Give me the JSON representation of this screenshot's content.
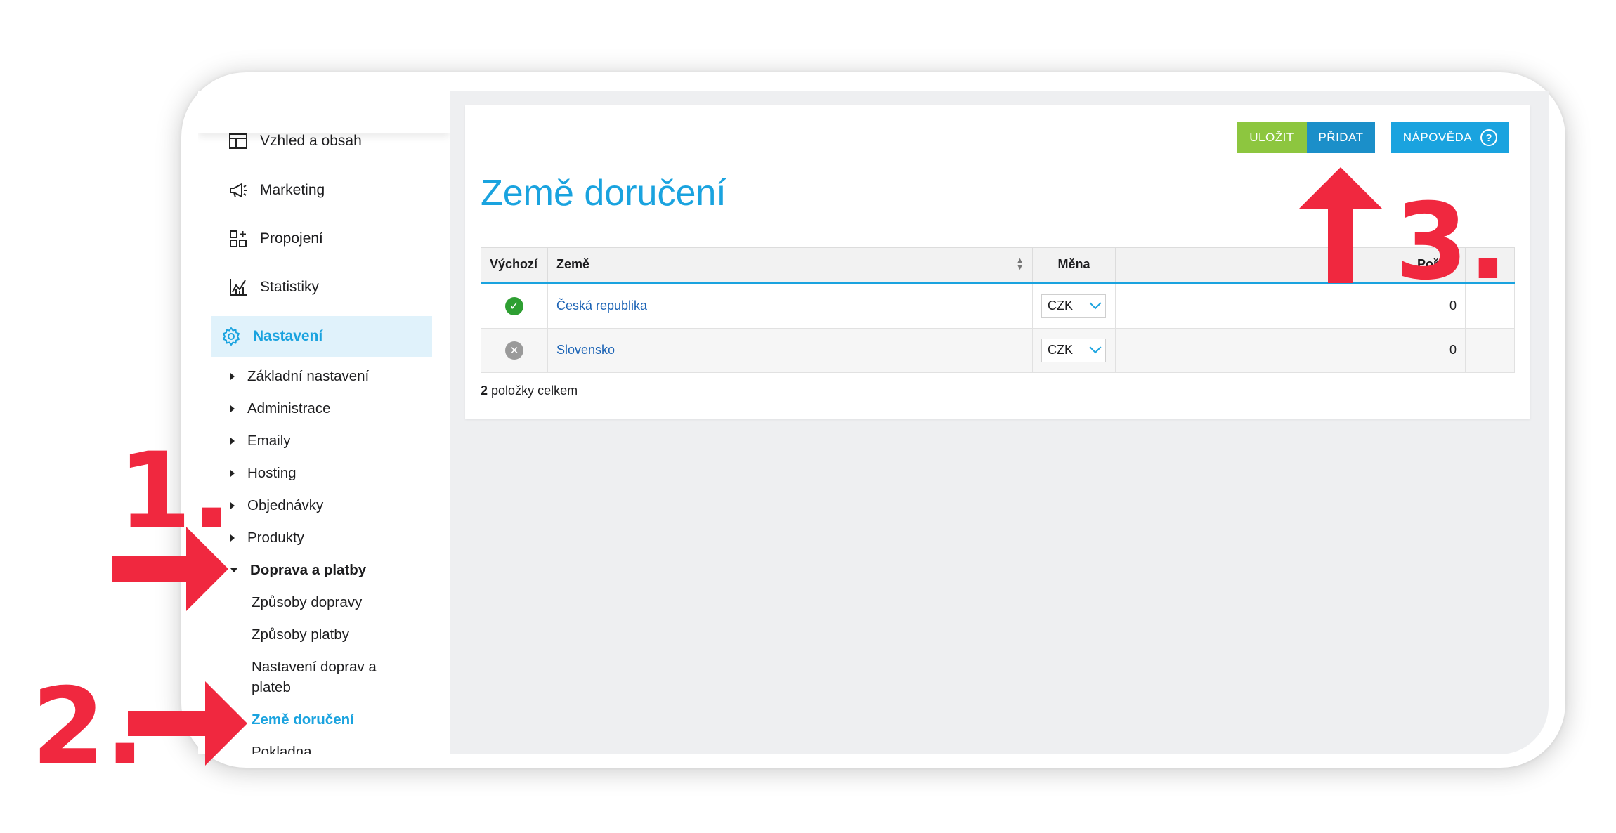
{
  "sidebar": {
    "items": [
      {
        "label": "Vzhled a obsah",
        "icon": "layout-icon"
      },
      {
        "label": "Marketing",
        "icon": "megaphone-icon"
      },
      {
        "label": "Propojení",
        "icon": "apps-plus-icon"
      },
      {
        "label": "Statistiky",
        "icon": "chart-icon"
      },
      {
        "label": "Nastavení",
        "icon": "gear-icon",
        "active": true
      }
    ],
    "settings_children": [
      "Základní nastavení",
      "Administrace",
      "Emaily",
      "Hosting",
      "Objednávky",
      "Produkty",
      "Doprava a platby"
    ],
    "shipping_children": [
      "Způsoby dopravy",
      "Způsoby platby",
      "Nastavení doprav a plateb",
      "Země doručení",
      "Pokladna"
    ]
  },
  "toolbar": {
    "save_label": "ULOŽIT",
    "add_label": "PŘIDAT",
    "help_label": "NÁPOVĚDA",
    "help_symbol": "?"
  },
  "page": {
    "title": "Země doručení"
  },
  "table": {
    "columns": [
      "Výchozí",
      "Země",
      "Měna",
      "Pořadí"
    ],
    "rows": [
      {
        "default": true,
        "country": "Česká republika",
        "currency": "CZK",
        "order": "0"
      },
      {
        "default": false,
        "country": "Slovensko",
        "currency": "CZK",
        "order": "0"
      }
    ],
    "count_number": "2",
    "count_text": "položky celkem"
  },
  "annotations": {
    "step1": "1.",
    "step2": "2.",
    "step3": "3.",
    "color": "#f0283f"
  },
  "colors": {
    "accent": "#1aa3df",
    "save": "#8dc63f",
    "add": "#1b8fc9",
    "ok": "#2e9f32"
  }
}
